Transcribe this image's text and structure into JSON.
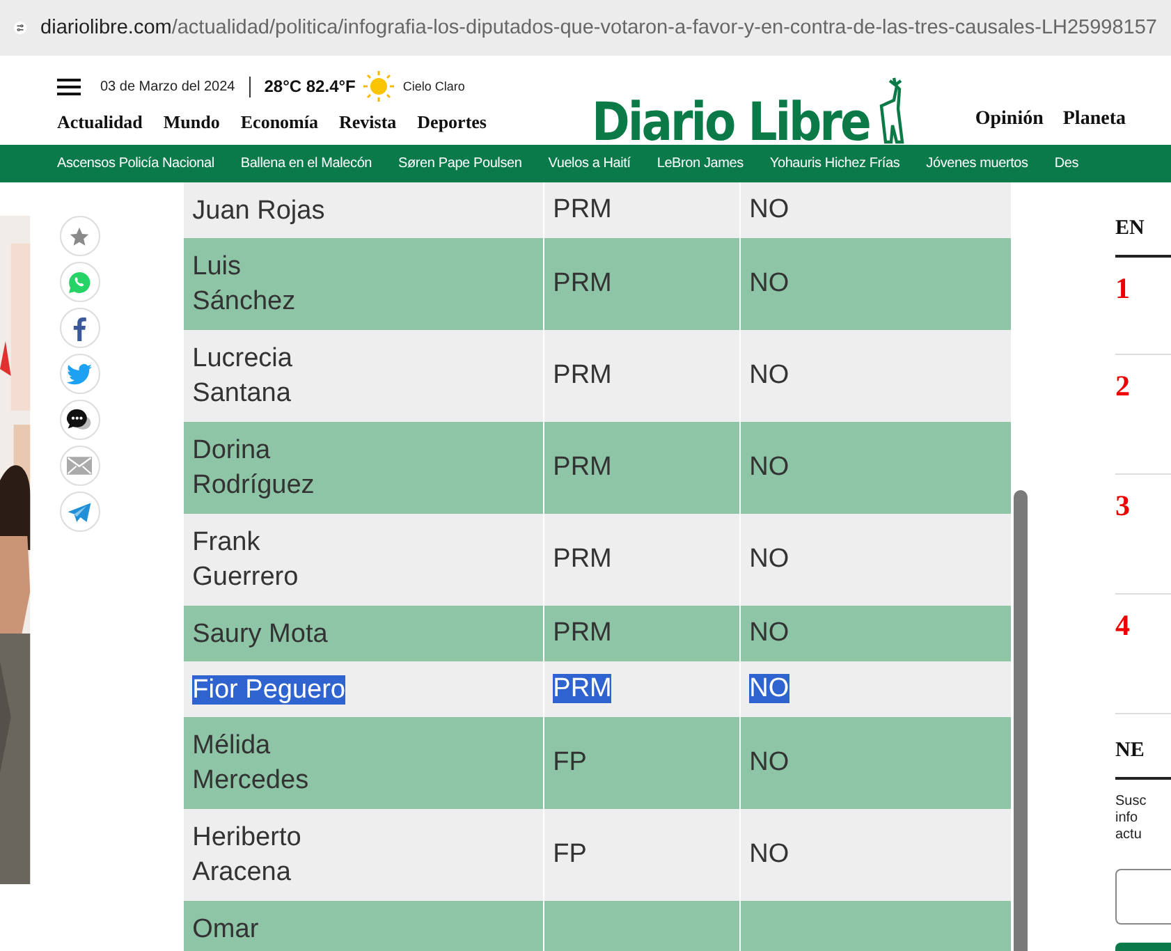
{
  "address_bar": {
    "domain": "diariolibre.com",
    "path": "/actualidad/politica/infografia-los-diputados-que-votaron-a-favor-y-en-contra-de-las-tres-causales-LH25998157"
  },
  "header": {
    "date": "03 de Marzo del 2024",
    "temperature": "28°C 82.4°F",
    "weather": "Cielo Claro",
    "logo": "Diario Libre",
    "nav_left": [
      "Actualidad",
      "Mundo",
      "Economía",
      "Revista",
      "Deportes"
    ],
    "nav_right": [
      "Opinión",
      "Planeta"
    ]
  },
  "trending": [
    "Ascensos Policía Nacional",
    "Ballena en el Malecón",
    "Søren Pape Poulsen",
    "Vuelos a Haití",
    "LeBron James",
    "Yohauris Hichez Frías",
    "Jóvenes muertos",
    "Des"
  ],
  "share_buttons": [
    {
      "kind": "star"
    },
    {
      "kind": "whatsapp"
    },
    {
      "kind": "facebook"
    },
    {
      "kind": "twitter"
    },
    {
      "kind": "comment"
    },
    {
      "kind": "email"
    },
    {
      "kind": "telegram"
    }
  ],
  "table": {
    "rows": [
      {
        "name": "Juan Rojas",
        "party": "PRM",
        "vote": "NO",
        "selected": false
      },
      {
        "name": "Luis\nSánchez",
        "party": "PRM",
        "vote": "NO",
        "selected": false
      },
      {
        "name": "Lucrecia\nSantana",
        "party": "PRM",
        "vote": "NO",
        "selected": false
      },
      {
        "name": "Dorina\nRodríguez",
        "party": "PRM",
        "vote": "NO",
        "selected": false
      },
      {
        "name": "Frank\nGuerrero",
        "party": "PRM",
        "vote": "NO",
        "selected": false
      },
      {
        "name": "Saury Mota",
        "party": "PRM",
        "vote": "NO",
        "selected": false
      },
      {
        "name": "Fior Peguero",
        "party": "PRM",
        "vote": "NO",
        "selected": true
      },
      {
        "name": "Mélida\nMercedes",
        "party": "FP",
        "vote": "NO",
        "selected": false
      },
      {
        "name": "Heriberto\nAracena",
        "party": "FP",
        "vote": "NO",
        "selected": false
      },
      {
        "name": "Omar",
        "selected": false
      }
    ]
  },
  "sidebar": {
    "heading": "EN",
    "ranks": [
      "1",
      "2",
      "3",
      "4"
    ],
    "newsletter_heading": "NE",
    "newsletter_text": "Susc\ninfo\nactu"
  }
}
